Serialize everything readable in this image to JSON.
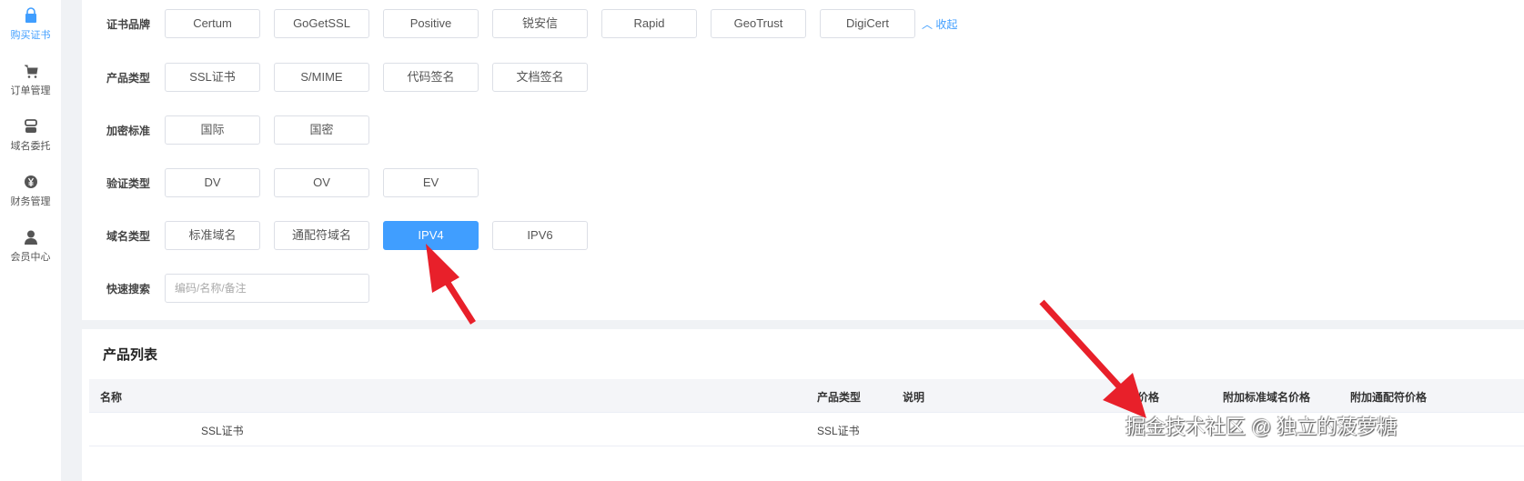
{
  "sidebar": {
    "items": [
      {
        "label": "购买证书",
        "icon": "shopping-bag-icon"
      },
      {
        "label": "订单管理",
        "icon": "cart-icon"
      },
      {
        "label": "域名委托",
        "icon": "server-icon"
      },
      {
        "label": "财务管理",
        "icon": "yen-icon"
      },
      {
        "label": "会员中心",
        "icon": "user-icon"
      }
    ]
  },
  "filters": {
    "brand": {
      "label": "证书品牌",
      "options": [
        "Certum",
        "GoGetSSL",
        "Positive",
        "锐安信",
        "Rapid",
        "GeoTrust",
        "DigiCert"
      ],
      "collapse": "收起"
    },
    "product_type": {
      "label": "产品类型",
      "options": [
        "SSL证书",
        "S/MIME",
        "代码签名",
        "文档签名"
      ]
    },
    "encryption": {
      "label": "加密标准",
      "options": [
        "国际",
        "国密"
      ]
    },
    "validation": {
      "label": "验证类型",
      "options": [
        "DV",
        "OV",
        "EV"
      ]
    },
    "domain_type": {
      "label": "域名类型",
      "options": [
        "标准域名",
        "通配符域名",
        "IPV4",
        "IPV6"
      ],
      "selected": "IPV4"
    },
    "search": {
      "label": "快速搜索",
      "placeholder": "编码/名称/备注",
      "value": ""
    }
  },
  "product_list": {
    "title": "产品列表",
    "columns": [
      "名称",
      "产品类型",
      "说明",
      "价格",
      "附加标准域名价格",
      "附加通配符价格"
    ],
    "rows": [
      {
        "name": "SSL证书",
        "type": "SSL证书"
      }
    ]
  },
  "watermark": "掘金技术社区 @ 独立的菠萝糖",
  "colors": {
    "accent": "#409eff",
    "arrow": "#e8202a"
  }
}
